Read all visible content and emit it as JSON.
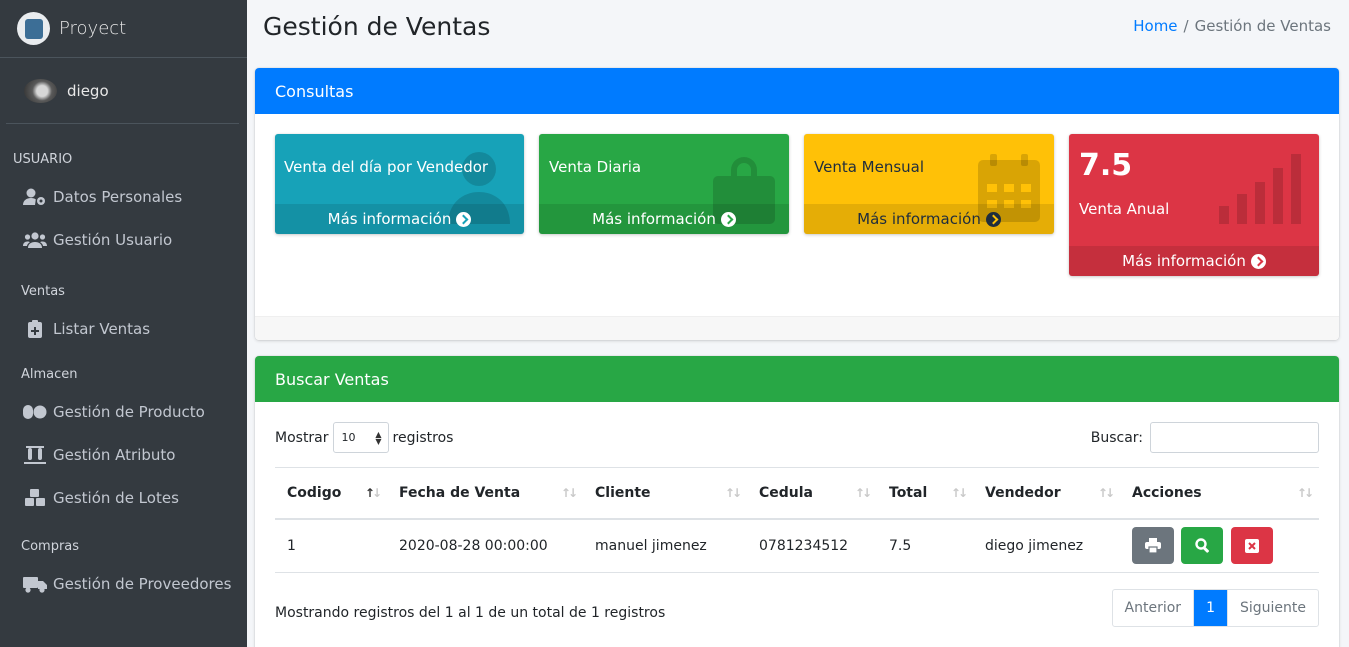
{
  "brand": {
    "name": "Proyect"
  },
  "user": {
    "name": "diego"
  },
  "sidebar": {
    "sections": [
      {
        "header": "USUARIO",
        "items": [
          {
            "label": "Datos Personales",
            "icon": "user-cog-icon"
          },
          {
            "label": "Gestión Usuario",
            "icon": "users-icon"
          }
        ]
      },
      {
        "header": "Ventas",
        "items": [
          {
            "label": "Listar Ventas",
            "icon": "clipboard-plus-icon"
          }
        ]
      },
      {
        "header": "Almacen",
        "items": [
          {
            "label": "Gestión de Producto",
            "icon": "pills-icon"
          },
          {
            "label": "Gestión Atributo",
            "icon": "vials-icon"
          },
          {
            "label": "Gestión de Lotes",
            "icon": "cubes-icon"
          }
        ]
      },
      {
        "header": "Compras",
        "items": [
          {
            "label": "Gestión de Proveedores",
            "icon": "truck-icon"
          }
        ]
      }
    ]
  },
  "header": {
    "title": "Gestión de Ventas",
    "breadcrumb": {
      "home": "Home",
      "sep": "/",
      "current": "Gestión de Ventas"
    }
  },
  "consultas": {
    "title": "Consultas",
    "boxes": [
      {
        "label": "Venta del día por Vendedor",
        "footer": "Más información",
        "color": "#17a2b8",
        "icon": "user-icon"
      },
      {
        "label": "Venta Diaria",
        "footer": "Más información",
        "color": "#28a745",
        "icon": "shopping-bag-icon"
      },
      {
        "label": "Venta Mensual",
        "footer": "Más información",
        "color": "#ffc107",
        "icon": "calendar-icon"
      },
      {
        "value": "7.5",
        "label": "Venta Anual",
        "footer": "Más información",
        "color": "#dc3545",
        "icon": "signal-icon"
      }
    ]
  },
  "buscar": {
    "title": "Buscar Ventas",
    "show_label": "Mostrar",
    "show_value": "10",
    "records_label": "registros",
    "search_label": "Buscar:",
    "search_value": "",
    "columns": [
      "Codigo",
      "Fecha de Venta",
      "Cliente",
      "Cedula",
      "Total",
      "Vendedor",
      "Acciones"
    ],
    "rows": [
      {
        "codigo": "1",
        "fecha": "2020-08-28 00:00:00",
        "cliente": "manuel jimenez",
        "cedula": "0781234512",
        "total": "7.5",
        "vendedor": "diego jimenez"
      }
    ],
    "info": "Mostrando registros del 1 al 1 de un total de 1 registros",
    "pager": {
      "prev": "Anterior",
      "current": "1",
      "next": "Siguiente"
    }
  }
}
